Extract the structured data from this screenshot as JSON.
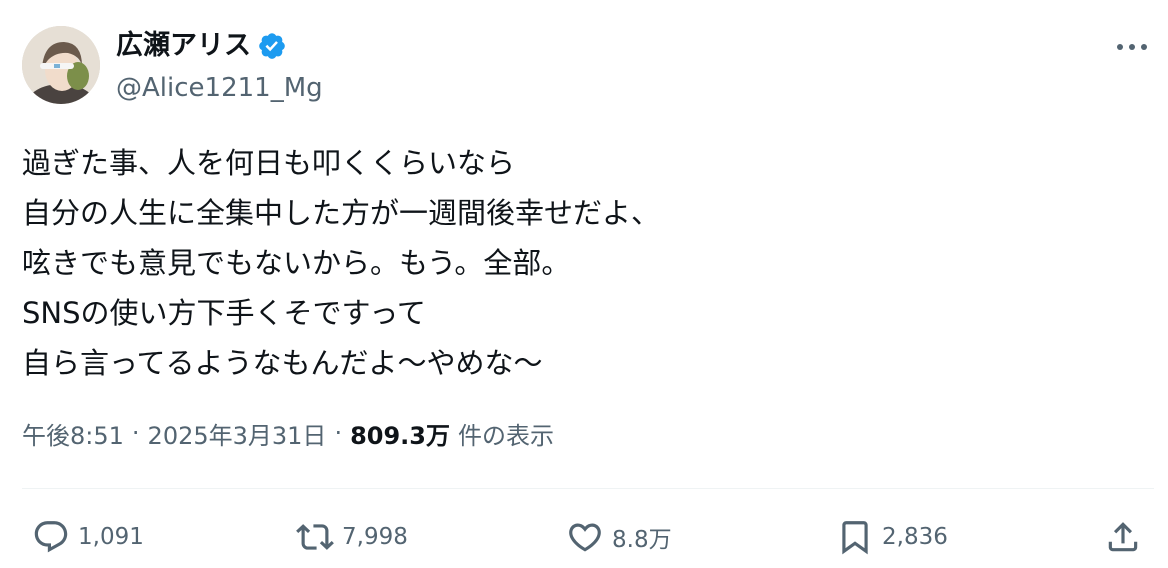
{
  "author": {
    "display_name": "広瀬アリス",
    "handle": "@Alice1211_Mg",
    "verified": true
  },
  "body_lines": [
    "過ぎた事、人を何日も叩くくらいなら",
    "自分の人生に全集中した方が一週間後幸せだよ、",
    "呟きでも意見でもないから。もう。全部。",
    "SNSの使い方下手くそですって",
    "自ら言ってるようなもんだよ〜やめな〜"
  ],
  "meta": {
    "time": "午後8:51",
    "date": "2025年3月31日",
    "separator": "·",
    "views_count": "809.3万",
    "views_label": "件の表示"
  },
  "actions": {
    "reply": {
      "count": "1,091",
      "icon": "reply-icon"
    },
    "retweet": {
      "count": "7,998",
      "icon": "retweet-icon"
    },
    "like": {
      "count": "8.8万",
      "icon": "heart-icon"
    },
    "bookmark": {
      "count": "2,836",
      "icon": "bookmark-icon"
    },
    "share": {
      "icon": "share-icon"
    }
  },
  "colors": {
    "text_primary": "#0f1419",
    "text_secondary": "#536471",
    "verified_blue": "#1d9bf0",
    "divider": "#eff3f4"
  }
}
